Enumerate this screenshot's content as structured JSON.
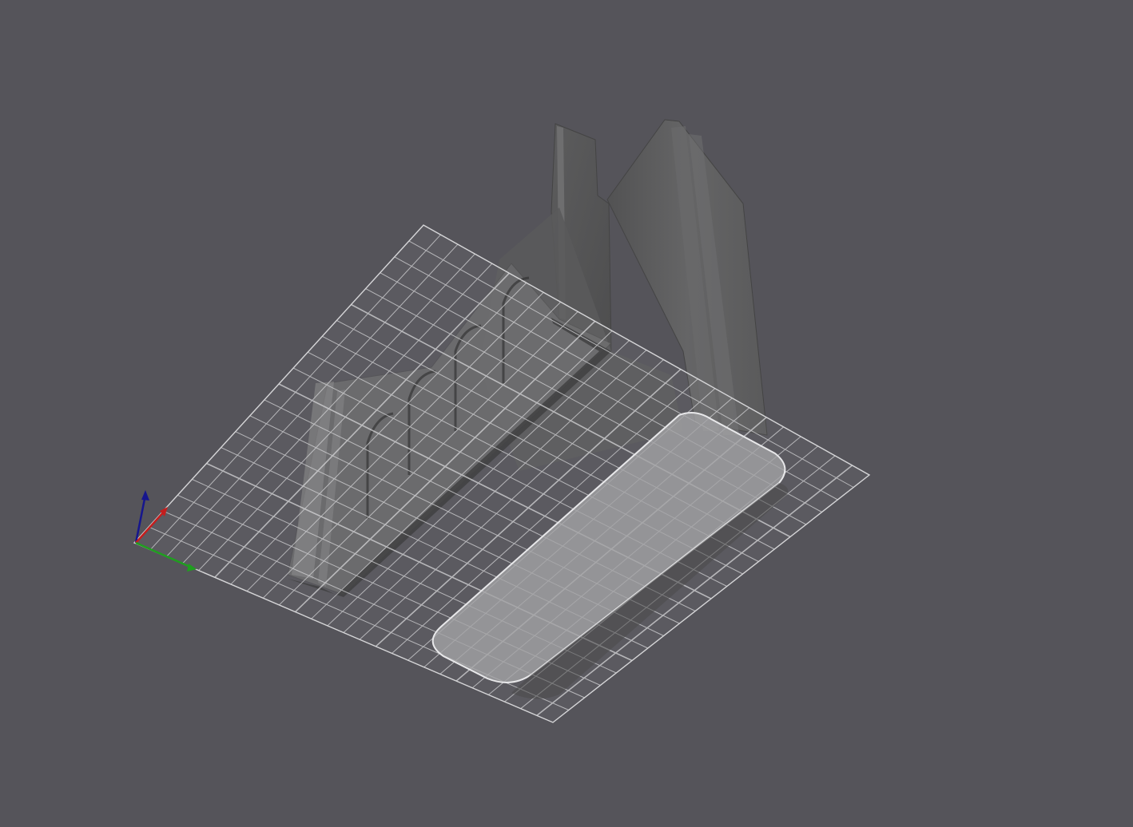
{
  "viewport": {
    "background": "#55545a",
    "model_color": "#5f5f60",
    "model_shadow": "#4a4a4b",
    "bed_grid_color": "#d6d6d8",
    "bed_pad_color": "#9a9a9c"
  },
  "axes": {
    "x_color": "#c41e1e",
    "y_color": "#1f9e1f",
    "z_color": "#16168e"
  },
  "grid": {
    "rows": 20,
    "cols": 26
  },
  "icons": [
    "axis-triad-icon"
  ]
}
